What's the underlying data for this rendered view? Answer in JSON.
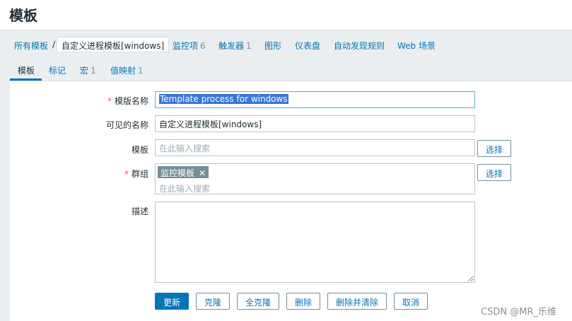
{
  "header": {
    "title": "模板"
  },
  "breadcrumb": {
    "all_templates": "所有模板",
    "separator": "/",
    "current": "自定义进程模板[windows]",
    "items": [
      {
        "label": "监控项",
        "count": "6"
      },
      {
        "label": "触发器",
        "count": "1"
      },
      {
        "label": "图形",
        "count": ""
      },
      {
        "label": "仪表盘",
        "count": ""
      },
      {
        "label": "自动发现规则",
        "count": ""
      },
      {
        "label": "Web 场景",
        "count": ""
      }
    ]
  },
  "tabs": [
    {
      "label": "模板",
      "count": ""
    },
    {
      "label": "标记",
      "count": ""
    },
    {
      "label": "宏",
      "count": "1"
    },
    {
      "label": "值映射",
      "count": "1"
    }
  ],
  "form": {
    "required_mark": "*",
    "template_name": {
      "label": "模版名称",
      "value": "Template process  for windows"
    },
    "visible_name": {
      "label": "可见的名称",
      "value": "自定义进程模板[windows]"
    },
    "templates": {
      "label": "模板",
      "placeholder": "在此输入搜索",
      "select_label": "选择"
    },
    "groups": {
      "label": "群组",
      "chip": "监控模板",
      "chip_remove": "✕",
      "placeholder": "在此输入搜索",
      "select_label": "选择"
    },
    "description": {
      "label": "描述",
      "value": ""
    }
  },
  "actions": {
    "update": "更新",
    "clone": "克隆",
    "full_clone": "全克隆",
    "delete": "删除",
    "delete_clear": "删除并清除",
    "cancel": "取消"
  },
  "watermark": "CSDN @MR_乐维",
  "colors": {
    "link": "#0275b8",
    "primary": "#0275b8",
    "required": "#e45959",
    "chip": "#768d99"
  }
}
